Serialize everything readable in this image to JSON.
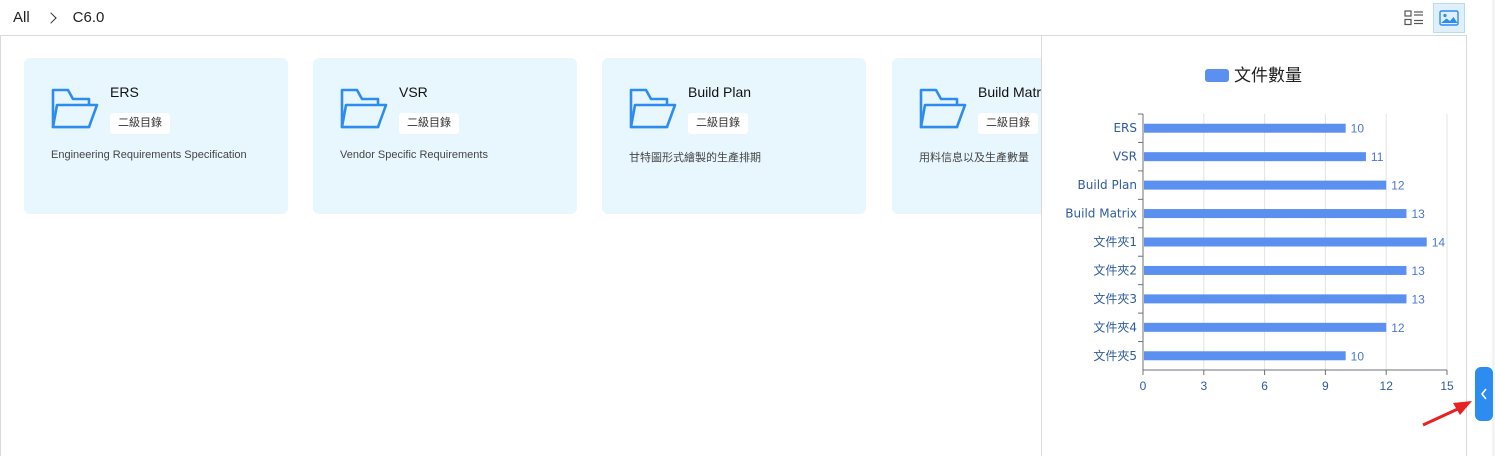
{
  "breadcrumb": {
    "root": "All",
    "current": "C6.0"
  },
  "toolbar": {
    "list_view_icon": "list-view-icon",
    "chart_view_icon": "chart-view-icon"
  },
  "cards": [
    {
      "title": "ERS",
      "tag": "二級目錄",
      "desc": "Engineering Requirements Specification"
    },
    {
      "title": "VSR",
      "tag": "二級目錄",
      "desc": "Vendor Specific Requirements"
    },
    {
      "title": "Build Plan",
      "tag": "二級目錄",
      "desc": "甘特圖形式繪製的生產排期"
    },
    {
      "title": "Build Matrix",
      "tag": "二級目錄",
      "desc": "用料信息以及生產數量"
    }
  ],
  "chart_data": {
    "type": "bar",
    "orientation": "horizontal",
    "legend": "文件數量",
    "legend_position": "top-center",
    "categories": [
      "ERS",
      "VSR",
      "Build Plan",
      "Build Matrix",
      "文件夾1",
      "文件夾2",
      "文件夾3",
      "文件夾4",
      "文件夾5"
    ],
    "values": [
      10,
      11,
      12,
      13,
      14,
      13,
      13,
      12,
      10
    ],
    "xlim": [
      0,
      15
    ],
    "xticks": [
      0,
      3,
      6,
      9,
      12,
      15
    ],
    "grid": true,
    "bar_color": "#5b8ff0",
    "label_color": "#4a76d6"
  },
  "colors": {
    "accent": "#2d8cf0",
    "card_bg": "#e8f7fe"
  }
}
